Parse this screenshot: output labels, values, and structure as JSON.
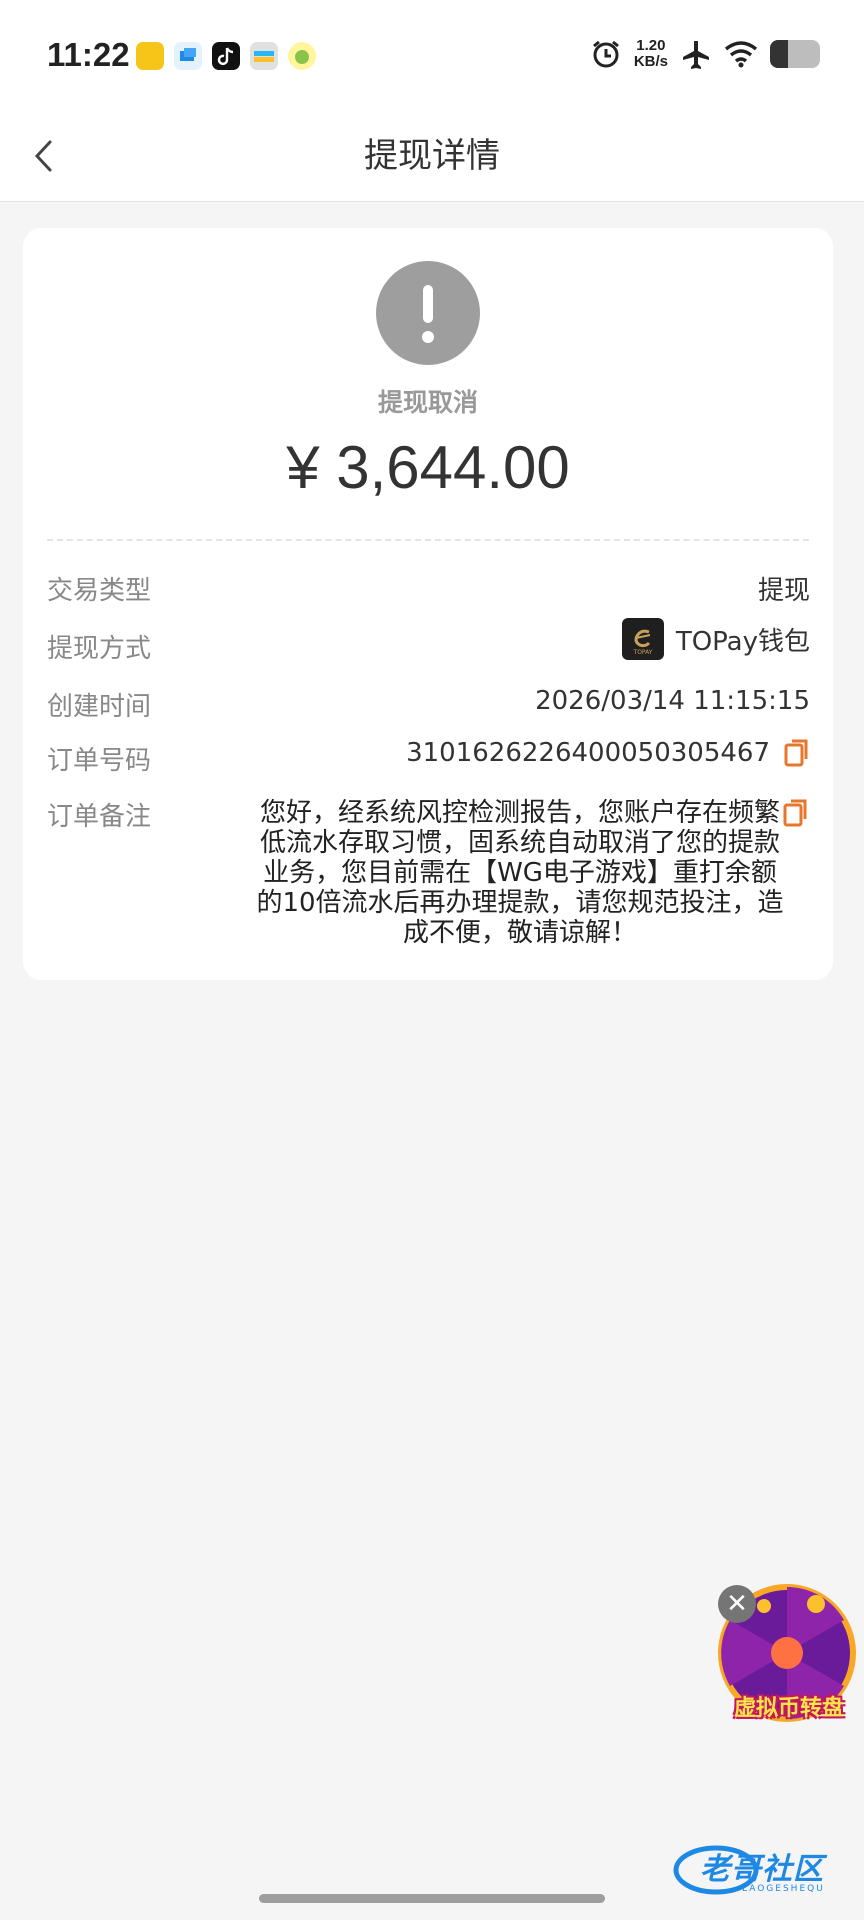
{
  "status_bar": {
    "time": "11:22",
    "net_speed_value": "1.20",
    "net_speed_unit": "KB/s",
    "icons": [
      "app-icon-1",
      "app-icon-2",
      "tiktok-icon",
      "app-icon-4",
      "app-icon-5",
      "alarm-icon",
      "airplane-icon",
      "wifi-icon",
      "battery-icon"
    ]
  },
  "nav": {
    "title": "提现详情",
    "back_icon": "chevron-left-icon"
  },
  "summary": {
    "status_icon": "exclamation-icon",
    "status_text": "提现取消",
    "amount": "¥ 3,644.00"
  },
  "details": {
    "type_label": "交易类型",
    "type_value": "提现",
    "method_label": "提现方式",
    "method_value": "TOPay钱包",
    "method_logo_text": "TOPAY",
    "created_label": "创建时间",
    "created_value": "2026/03/14 11:15:15",
    "order_label": "订单号码",
    "order_value": "3101626226400050305467",
    "remark_label": "订单备注",
    "remark_value": "您好，经系统风控检测报告，您账户存在频繁低流水存取习惯，固系统自动取消了您的提款业务，您目前需在【WG电子游戏】重打余额的10倍流水后再办理提款，请您规范投注，造成不便，敬请谅解！"
  },
  "floating": {
    "label": "虚拟币转盘",
    "close_symbol": "✕"
  },
  "watermark": {
    "text": "老哥社区",
    "subtext": "LAOGESHEQU"
  },
  "colors": {
    "accent_orange": "#e8762b",
    "status_gray": "#9e9e9e",
    "background": "#f5f5f6"
  }
}
